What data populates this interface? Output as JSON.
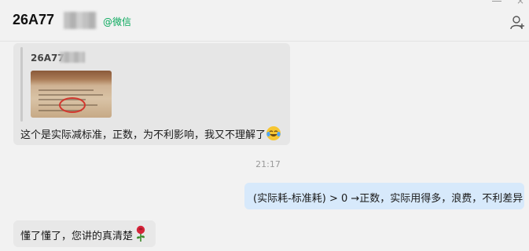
{
  "header": {
    "contact_name": "26A77",
    "source_tag": "@微信",
    "add_member_icon": "add-member-icon"
  },
  "messages": {
    "quoted": {
      "author": "26A77",
      "image_icon": "photo-thumbnail",
      "text": "这个是实际减标准，正数，为不利影响，我又不理解了",
      "emoji": "laughing-crying-emoji"
    },
    "timestamp": "21:17",
    "mine": {
      "text": "(实际耗-标准耗) > 0 →正数，实际用得多，浪费，不利差异"
    },
    "reply": {
      "text": "懂了懂了，您讲的真清楚",
      "emoji": "rose-emoji"
    }
  },
  "colors": {
    "background": "#f2f2f2",
    "incoming_bubble": "#e8e8e8",
    "outgoing_bubble": "#d7e9fb",
    "source_tag": "#07a85b"
  }
}
